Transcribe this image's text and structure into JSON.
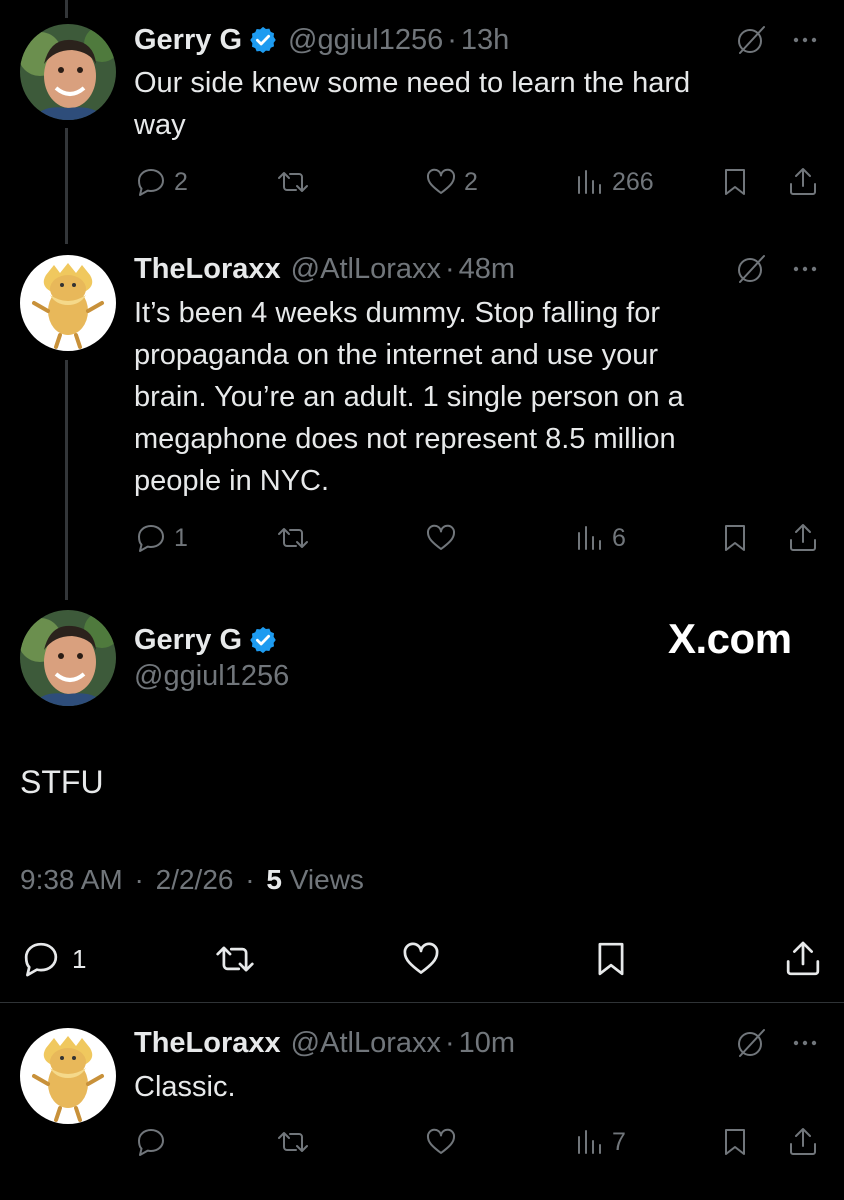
{
  "tweets": [
    {
      "name": "Gerry G",
      "handle": "@ggiul1256",
      "time": "13h",
      "text_lines": [
        "Our side knew some need to learn the hard",
        "way"
      ],
      "replies": "2",
      "reposts": "",
      "likes": "2",
      "views": "266"
    },
    {
      "name": "TheLoraxx",
      "handle": "@AtlLoraxx",
      "time": "48m",
      "text_lines": [
        "It’s been 4 weeks dummy. Stop falling for",
        "propaganda on the internet and use your",
        "brain. You’re an adult. 1 single person on a",
        "megaphone does not represent 8.5 million",
        "people in NYC."
      ],
      "replies": "1",
      "reposts": "",
      "likes": "",
      "views": "6"
    },
    {
      "name": "TheLoraxx",
      "handle": "@AtlLoraxx",
      "time": "10m",
      "text_lines": [
        "Classic."
      ],
      "replies": "",
      "reposts": "",
      "likes": "",
      "views": "7"
    }
  ],
  "main_tweet": {
    "name": "Gerry G",
    "handle": "@ggiul1256",
    "watermark": "X.com",
    "text": "STFU",
    "time": "9:38 AM",
    "date": "2/2/26",
    "views_count": "5",
    "views_label": "Views",
    "replies": "1"
  },
  "separator": "·",
  "colors": {
    "background": "#000000",
    "text": "#e7e9ea",
    "muted": "#71767b",
    "verified": "#1d9bf0",
    "thread_line": "#333639"
  },
  "icons": [
    "verified-badge-icon",
    "grok-icon",
    "more-icon",
    "reply-icon",
    "repost-icon",
    "like-icon",
    "views-icon",
    "bookmark-icon",
    "share-icon"
  ]
}
